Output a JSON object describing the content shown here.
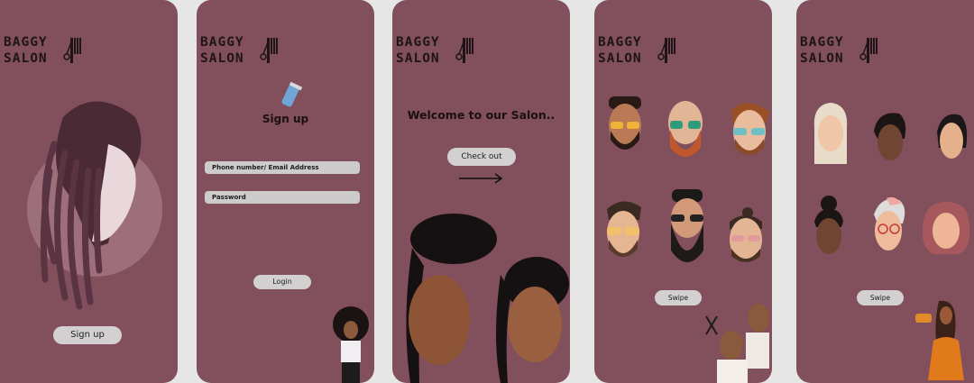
{
  "brand": {
    "line1": "BAGGY",
    "line2": "SALON"
  },
  "screen1": {
    "signup_button": "Sign up"
  },
  "screen2": {
    "title": "Sign up",
    "fields": [
      {
        "placeholder": "Phone number/ Email Address"
      },
      {
        "placeholder": "Password"
      }
    ],
    "login_button": "Login"
  },
  "screen3": {
    "title": "Welcome to our Salon..",
    "checkout_button": "Check out"
  },
  "screen4": {
    "swipe_button": "Swipe",
    "styles": [
      "men-style-1",
      "men-style-2",
      "men-style-3",
      "men-style-4",
      "men-style-5",
      "men-style-6"
    ]
  },
  "screen5": {
    "swipe_button": "Swipe",
    "styles": [
      "women-style-1",
      "women-style-2",
      "women-style-3",
      "women-style-4",
      "women-style-5",
      "women-style-6"
    ]
  },
  "colors": {
    "background": "#e6e6e6",
    "screen": "#824f5c",
    "button": "#d3d0d1",
    "text": "#1f1418"
  },
  "icons": [
    "comb-scissors-icon",
    "hair-clipper-icon",
    "arrow-right-icon"
  ]
}
